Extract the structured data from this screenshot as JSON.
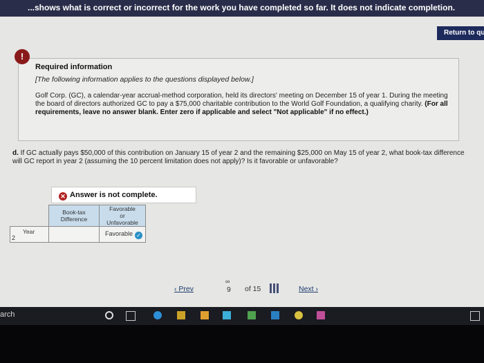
{
  "banner": {
    "text": "...shows what is correct or incorrect for the work you have completed so far. It does not indicate completion."
  },
  "return_button": {
    "label": "Return to que"
  },
  "info": {
    "badge": "!",
    "title": "Required information",
    "subtitle": "[The following information applies to the questions displayed below.]",
    "body": "Golf Corp. (GC), a calendar-year accrual-method corporation, held its directors' meeting on December 15 of year 1. During the meeting the board of directors authorized GC to pay a $75,000 charitable contribution to the World Golf Foundation, a qualifying charity.",
    "instruction": "(For all requirements, leave no answer blank. Enter zero if applicable and select \"Not applicable\" if no effect.)"
  },
  "question": {
    "prefix": "d.",
    "text": "If GC actually pays $50,000 of this contribution on January 15 of year 2 and the remaining $25,000 on May 15 of year 2, what book-tax difference will GC report in year 2 (assuming the 10 percent limitation does not apply)? Is it favorable or unfavorable?"
  },
  "answer": {
    "status": "Answer is not complete.",
    "col1_header": "Book-tax Difference",
    "col2_header_lines": [
      "Favorable",
      "or",
      "Unfavorable"
    ],
    "row_label": "Year",
    "year_value": "2",
    "book_tax_value": "",
    "favorable_value": "Favorable"
  },
  "pager": {
    "prev": "Prev",
    "current": "9",
    "of": "of 15",
    "next": "Next"
  },
  "taskbar": {
    "search": "arch"
  },
  "colors": {
    "banner": "#2a2d4a",
    "return_button": "#1d2a5c",
    "table_header": "#c8dcec",
    "error": "#b0221f",
    "check": "#2a8fc6"
  }
}
